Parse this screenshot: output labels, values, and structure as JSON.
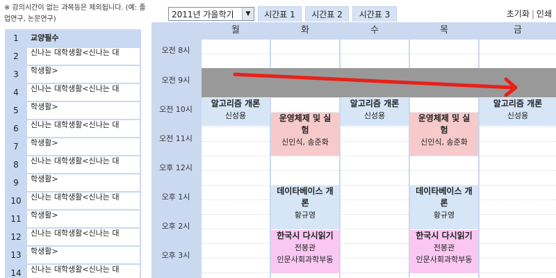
{
  "notice": "※ 강의시간이 없는 과목등은 제외됩니다. (예: 졸업연구, 논문연구)",
  "semester_select": {
    "value": "2011년 가을학기"
  },
  "tabs": [
    "시간표 1",
    "시간표 2",
    "시간표 3"
  ],
  "links": {
    "reset": "초기화",
    "print": "인쇄"
  },
  "sidebar": {
    "numbers": [
      "1",
      "2",
      "3",
      "4",
      "5",
      "6",
      "7",
      "8",
      "9",
      "10",
      "11",
      "12",
      "13",
      "14"
    ],
    "header": "교양필수",
    "course_line1": "신나는 대학생활<신나는 대",
    "course_line2": "학생활>"
  },
  "days": [
    "월",
    "화",
    "수",
    "목",
    "금"
  ],
  "times": [
    "오전 8시",
    "오전 9시",
    "오전 10시",
    "오전 11시",
    "오후 12시",
    "오후 1시",
    "오후 2시",
    "오후 3시"
  ],
  "courses": {
    "algorithms": {
      "name": "알고리즘 개론",
      "prof": "신성용"
    },
    "os": {
      "name_line1": "운영체제 및 실",
      "name_line2": "험",
      "prof": "신인식, 송준화"
    },
    "db": {
      "name_line1": "데이타베이스 개",
      "name_line2": "론",
      "prof": "황규영"
    },
    "poetry": {
      "name": "한국시 다시읽기",
      "prof": "전봉관",
      "dept": "인문사회과학부동"
    }
  },
  "colors": {
    "accent_arrow": "#e8201a",
    "gray_band": "#999999",
    "grid_bg": "#cad9f0"
  }
}
